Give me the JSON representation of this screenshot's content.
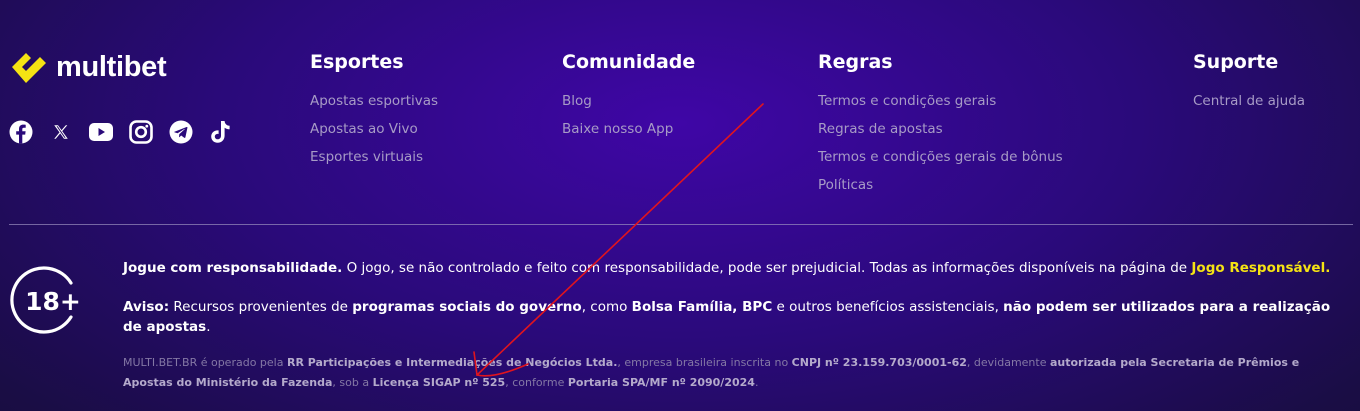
{
  "brand": {
    "name": "multibet",
    "accent": "#f5e313"
  },
  "social": [
    {
      "icon": "facebook-icon"
    },
    {
      "icon": "x-icon"
    },
    {
      "icon": "youtube-icon"
    },
    {
      "icon": "instagram-icon"
    },
    {
      "icon": "telegram-icon"
    },
    {
      "icon": "tiktok-icon"
    }
  ],
  "columns": {
    "esportes": {
      "title": "Esportes",
      "links": [
        "Apostas esportivas",
        "Apostas ao Vivo",
        "Esportes virtuais"
      ]
    },
    "comunidade": {
      "title": "Comunidade",
      "links": [
        "Blog",
        "Baixe nosso App"
      ]
    },
    "regras": {
      "title": "Regras",
      "links": [
        "Termos e condições gerais",
        "Regras de apostas",
        "Termos e condições gerais de bônus",
        "Políticas"
      ]
    },
    "suporte": {
      "title": "Suporte",
      "links": [
        "Central de ajuda"
      ]
    }
  },
  "age_badge": "18+",
  "notice1": {
    "strong": "Jogue com responsabilidade.",
    "text": " O jogo, se não controlado e feito com responsabilidade, pode ser prejudicial. Todas as informações disponíveis na página de ",
    "link": "Jogo Responsável."
  },
  "notice2": {
    "label": "Aviso:",
    "t1": " Recursos provenientes de ",
    "b1": "programas sociais do governo",
    "t2": ", como ",
    "b2": "Bolsa Família, BPC",
    "t3": " e outros benefícios assistenciais, ",
    "b3": "não podem ser utilizados para a realização de apostas",
    "t4": "."
  },
  "legal": {
    "p1": "MULTI.BET.BR é operado pela ",
    "b1": "RR Participações e Intermediações de Negócios Ltda.",
    "p2": ", empresa brasileira inscrita no ",
    "b2": "CNPJ nº 23.159.703/0001-62",
    "p3": ", devidamente ",
    "b3": "autorizada pela Secretaria de Prêmios e Apostas do Ministério da Fazenda",
    "p4": ", sob a ",
    "b4": "Licença SIGAP nº 525",
    "p5": ", conforme ",
    "b5": "Portaria SPA/MF nº 2090/2024",
    "p6": "."
  }
}
